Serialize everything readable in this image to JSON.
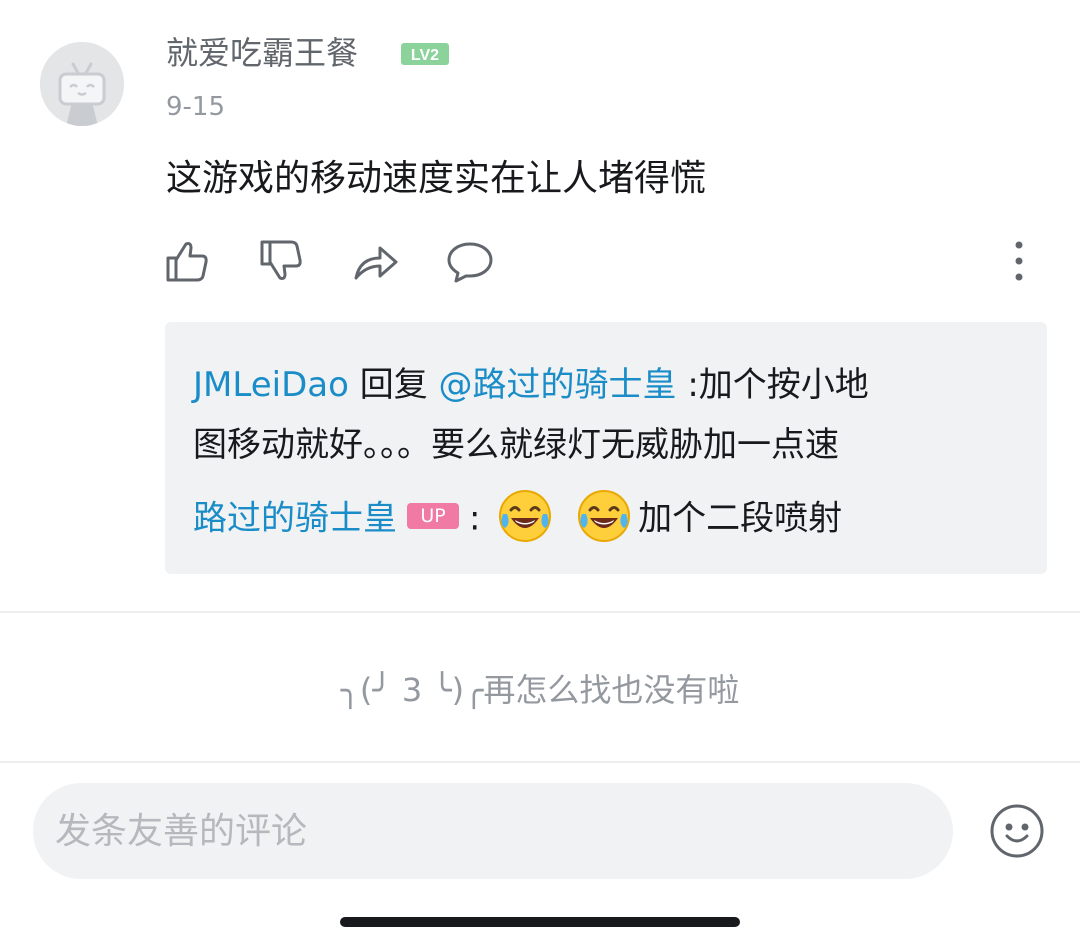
{
  "comment": {
    "username": "就爱吃霸王餐",
    "level_badge": "LV2",
    "date": "9-15",
    "text": "这游戏的移动速度实在让人堵得慌"
  },
  "replies": {
    "first": {
      "author": "JMLeiDao",
      "verb": " 回复 ",
      "mention": "@路过的骑士皇",
      "text_line1": " :加个按小地",
      "text_line2": "图移动就好。。。要么就绿灯无威胁加一点速"
    },
    "second": {
      "author": "路过的骑士皇",
      "badge": "UP",
      "separator": ":",
      "text": "加个二段喷射",
      "emoji_icons": [
        "laughing-crying-emoji",
        "laughing-crying-emoji"
      ]
    }
  },
  "end_message": "╮(╯ 3 ╰)╭再怎么找也没有啦",
  "composer": {
    "placeholder": "发条友善的评论"
  },
  "icons": {
    "like": "thumbs-up-icon",
    "dislike": "thumbs-down-icon",
    "share": "share-icon",
    "reply": "comment-icon",
    "more": "more-vertical-icon",
    "emoji": "smiley-icon"
  },
  "colors": {
    "link": "#1a8dc9",
    "up_badge": "#f07aa3",
    "level_badge": "#8bd29b"
  }
}
